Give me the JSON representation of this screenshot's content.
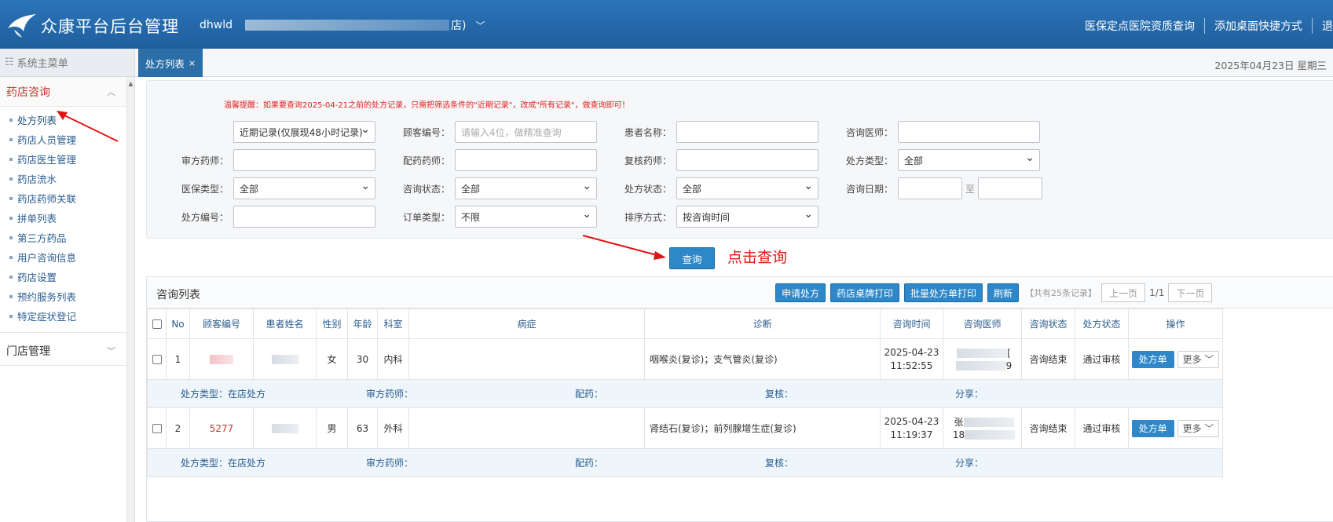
{
  "header": {
    "app_title": "众康平台后台管理",
    "account_prefix": "dhwld",
    "account_suffix": "店)",
    "links": [
      "医保定点医院资质查询",
      "添加桌面快捷方式",
      "退"
    ]
  },
  "sidebar": {
    "menu_title": "系统主菜单",
    "groups": [
      {
        "label": "药店咨询",
        "items": [
          "处方列表",
          "药店人员管理",
          "药店医生管理",
          "药店流水",
          "药店药师关联",
          "拼单列表",
          "第三方药品",
          "用户咨询信息",
          "药店设置",
          "预约服务列表",
          "特定症状登记"
        ]
      },
      {
        "label": "门店管理",
        "items": []
      }
    ]
  },
  "tabs": {
    "active_label": "处方列表",
    "close_glyph": "×",
    "date_text": "2025年04月23日 星期三"
  },
  "filters": {
    "warning": "温馨提醒：如果要查询2025-04-21之前的处方记录，只需把筛选条件的\"近期记录\"，改成\"所有记录\"，做查询即可！",
    "record_range": "近期记录(仅展现48小时记录)",
    "customer_no_label": "顾客编号：",
    "customer_no_placeholder": "请输入4位，做精准查询",
    "patient_name_label": "患者名称：",
    "consult_doctor_label": "咨询医师：",
    "review_pharmacist_label": "审方药师：",
    "dispense_pharmacist_label": "配药药师：",
    "recheck_pharmacist_label": "复核药师：",
    "rx_type_label": "处方类型：",
    "rx_type_value": "全部",
    "insurance_type_label": "医保类型：",
    "insurance_type_value": "全部",
    "consult_status_label": "咨询状态：",
    "consult_status_value": "全部",
    "rx_status_label": "处方状态：",
    "rx_status_value": "全部",
    "consult_date_label": "咨询日期：",
    "date_to": "至",
    "rx_no_label": "处方编号：",
    "order_type_label": "订单类型：",
    "order_type_value": "不限",
    "sort_label": "排序方式：",
    "sort_value": "按咨询时间",
    "query_button": "查询",
    "annotation": "点击查询"
  },
  "list": {
    "title": "咨询列表",
    "buttons": [
      "申请处方",
      "药店桌牌打印",
      "批量处方单打印",
      "刷新"
    ],
    "record_count": "【共有25条记录】",
    "prev_page": "上一页",
    "page_info": "1/1",
    "next_page": "下一页",
    "columns": [
      "No",
      "顾客编号",
      "患者姓名",
      "性别",
      "年龄",
      "科室",
      "病症",
      "诊断",
      "咨询时间",
      "咨询医师",
      "咨询状态",
      "处方状态",
      "操作"
    ],
    "rows": [
      {
        "no": "1",
        "customer_no": "",
        "gender": "女",
        "age": "30",
        "dept": "内科",
        "symptom": "",
        "diagnosis": "咽喉炎(复诊)；支气管炎(复诊)",
        "date": "2025-04-23",
        "time": "11:52:55",
        "doctor_a": "[",
        "doctor_b": "9",
        "consult_status": "咨询结束",
        "rx_status": "通过审核",
        "rx_button": "处方单",
        "more_button": "更多",
        "rx_type_label": "处方类型：",
        "rx_type_value": "在店处方",
        "review_label": "审方药师：",
        "dispense_label": "配药：",
        "recheck_label": "复核：",
        "share_label": "分享："
      },
      {
        "no": "2",
        "customer_no": "5277",
        "gender": "男",
        "age": "63",
        "dept": "外科",
        "symptom": "",
        "diagnosis": "肾结石(复诊)；前列腺增生症(复诊)",
        "date": "2025-04-23",
        "time": "11:19:37",
        "doctor_a": "张",
        "doctor_b": "18",
        "consult_status": "咨询结束",
        "rx_status": "通过审核",
        "rx_button": "处方单",
        "more_button": "更多",
        "rx_type_label": "处方类型：",
        "rx_type_value": "在店处方",
        "review_label": "审方药师：",
        "dispense_label": "配药：",
        "recheck_label": "复核：",
        "share_label": "分享："
      }
    ]
  },
  "colors": {
    "header_blue": "#2b74b8",
    "button_blue": "#2e87c8",
    "accent_red": "#e01515"
  }
}
